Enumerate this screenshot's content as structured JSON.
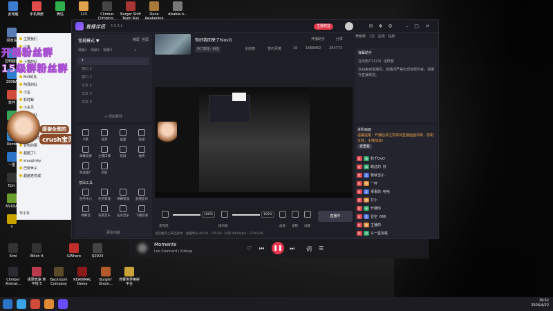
{
  "desktop": {
    "icons_top": [
      {
        "label": "此电脑",
        "color": "#3b7bd1"
      },
      {
        "label": "手机相册",
        "color": "#e24b4b"
      },
      {
        "label": "微信",
        "color": "#2fb04a"
      },
      {
        "label": "123",
        "color": "#e0a24a"
      },
      {
        "label": "Climber Climbing...",
        "color": "#444"
      },
      {
        "label": "Burger Shift Team Run",
        "color": "#a33"
      },
      {
        "label": "Dune Awakening",
        "color": "#a87a3a"
      },
      {
        "label": "disable-n...",
        "color": "#777"
      }
    ],
    "icons_left": [
      {
        "label": "回收站",
        "color": "#5a7bb5"
      },
      {
        "label": "控制面板",
        "color": "#3a82c8"
      },
      {
        "label": "299BA",
        "color": "#2f7fd1"
      },
      {
        "label": "软件",
        "color": "#d04b3a"
      },
      {
        "label": "腾讯",
        "color": "#3aa35a"
      },
      {
        "label": "Demo",
        "color": "#2d8ad6"
      },
      {
        "label": "一墨",
        "color": "#2b73c6"
      },
      {
        "label": "Epic",
        "color": "#333"
      },
      {
        "label": "NVIDIA",
        "color": "#6a9d2b"
      },
      {
        "label": "Y",
        "color": "#c9a300"
      }
    ],
    "icons_bottom": [
      {
        "label": "Kimi",
        "color": "#333"
      },
      {
        "label": "Witch It",
        "color": "#333"
      },
      {
        "label": "Climber Animal...",
        "color": "#2b2b35"
      },
      {
        "label": "极限竞速 地平线 5",
        "color": "#b83a4d"
      },
      {
        "label": "GWhere",
        "color": "#c02d2d"
      },
      {
        "label": "Q2023",
        "color": "#444"
      },
      {
        "label": "Backroom Company",
        "color": "#5a4b2a"
      },
      {
        "label": "REANIMAL Demo",
        "color": "#8a1a1a"
      },
      {
        "label": "Burglin' Gnom...",
        "color": "#b25a2a"
      },
      {
        "label": "竞赛世界奥拼平台",
        "color": "#c9a23a"
      }
    ]
  },
  "overlay": {
    "line1": "开播粉丝群",
    "line2": "15级群粉丝群",
    "tag1": "感谢全图的",
    "tag2": "crush宝贝"
  },
  "qq": {
    "rows": [
      "主要我们",
      "小鱼",
      "看看",
      "小猫的队",
      "小黑屋",
      "Mr3的队",
      "阿泽的队",
      "小宝",
      "彩虹鲸",
      "小主贝",
      "新一的队",
      "九儿的队",
      "公众管理",
      "我的爱男友",
      "爱吃的那",
      "超越了1",
      "sraughsky",
      "巴黎世子",
      "超越老花城"
    ],
    "footer": "爷小冬"
  },
  "app": {
    "name": "直播伴侣",
    "version": "5.5.9.1",
    "publish_btn": "主播权益",
    "title_icons": [
      "消息",
      "设置",
      "最小化",
      "关闭"
    ]
  },
  "left": {
    "mode": "常规模式 ▼",
    "mode_tabs": [
      "横屏",
      "竖屏"
    ],
    "scene_tabs": [
      "场景1",
      "场景2",
      "场景3"
    ],
    "scenes": [
      "Y",
      "窗口 2",
      "窗口 3",
      "文本 4",
      "文本 5",
      "文本 6"
    ],
    "add_material": "+ 添加素材",
    "tools_top": [
      "K歌",
      "道具",
      "画面",
      "贴纸",
      "弹幕投屏",
      "主播口播",
      "投屏",
      "抽奖",
      "商品推广",
      "高级"
    ],
    "section": "基础工具",
    "tools_bottom": [
      "任务中心",
      "任务管理",
      "弹幕管理",
      "直播变声",
      "弹幕话",
      "背景音乐",
      "任务音乐",
      "下播答谢"
    ],
    "more": "更多功能"
  },
  "center": {
    "room_title": "你好我回来了hiovO",
    "room_cat": "热门游戏 - 射击",
    "stats": [
      "全站榜",
      "签约月榜",
      "16",
      "1668882",
      "254773"
    ],
    "links": [
      "开播助手",
      "分享"
    ],
    "mic_label": "麦克风",
    "mic_pct": "100%",
    "spk_label": "扬声器",
    "spk_pct": "100%",
    "ctrl_labels": [
      "画质",
      "录制",
      "设置"
    ],
    "live_btn": "直播中",
    "status": "当前推流上来连接中 · 直播时长 00:00 · FPS:60 · 码率:4000kb/s · CPU:12%"
  },
  "right": {
    "tabs": [
      "贡献榜",
      "1万",
      "在线",
      "钻粉"
    ],
    "helper": "弹幕助手",
    "online": "在线用户(124)",
    "hot": "活跃度",
    "notice": "欢迎来到直播间，直播间严禁出现违规内容，请遵守直播规范。",
    "alert_title": "进阶画面",
    "alert": "温馨提醒：开播后请注意保持直播画面清晰，感谢支持，主播加油！",
    "goto": "去查看",
    "chats": [
      {
        "badges": [
          "红",
          "绿"
        ],
        "name": "秋千OvO",
        "msg": ""
      },
      {
        "badges": [
          "红",
          "绿"
        ],
        "name": "路过的",
        "msg": "好"
      },
      {
        "badges": [
          "红",
          "蓝"
        ],
        "name": "我就当小",
        "msg": ""
      },
      {
        "badges": [
          "红",
          "橙"
        ],
        "name": "一杯",
        "msg": ""
      },
      {
        "badges": [
          "红",
          "蓝"
        ],
        "name": "事事的",
        "msg": "哈哈"
      },
      {
        "badges": [
          "红",
          "橙"
        ],
        "name": "打小",
        "msg": ""
      },
      {
        "badges": [
          "红",
          "绿"
        ],
        "name": "开播你",
        "msg": ""
      },
      {
        "badges": [
          "红",
          "蓝"
        ],
        "name": "显空",
        "msg": "666"
      },
      {
        "badges": [
          "红",
          "橙"
        ],
        "name": "主播的",
        "msg": ""
      },
      {
        "badges": [
          "红",
          "绿"
        ],
        "name": "么一直加载",
        "msg": ""
      }
    ]
  },
  "player": {
    "song": "Moments",
    "artist": "Leo Stannard / Kidnap"
  },
  "taskbar": {
    "time": "19:52",
    "date": "2026/4/22"
  },
  "colors": {
    "accent": "#e8344e",
    "brand": "#6b4bff",
    "window_bg": "#1d1e26"
  }
}
